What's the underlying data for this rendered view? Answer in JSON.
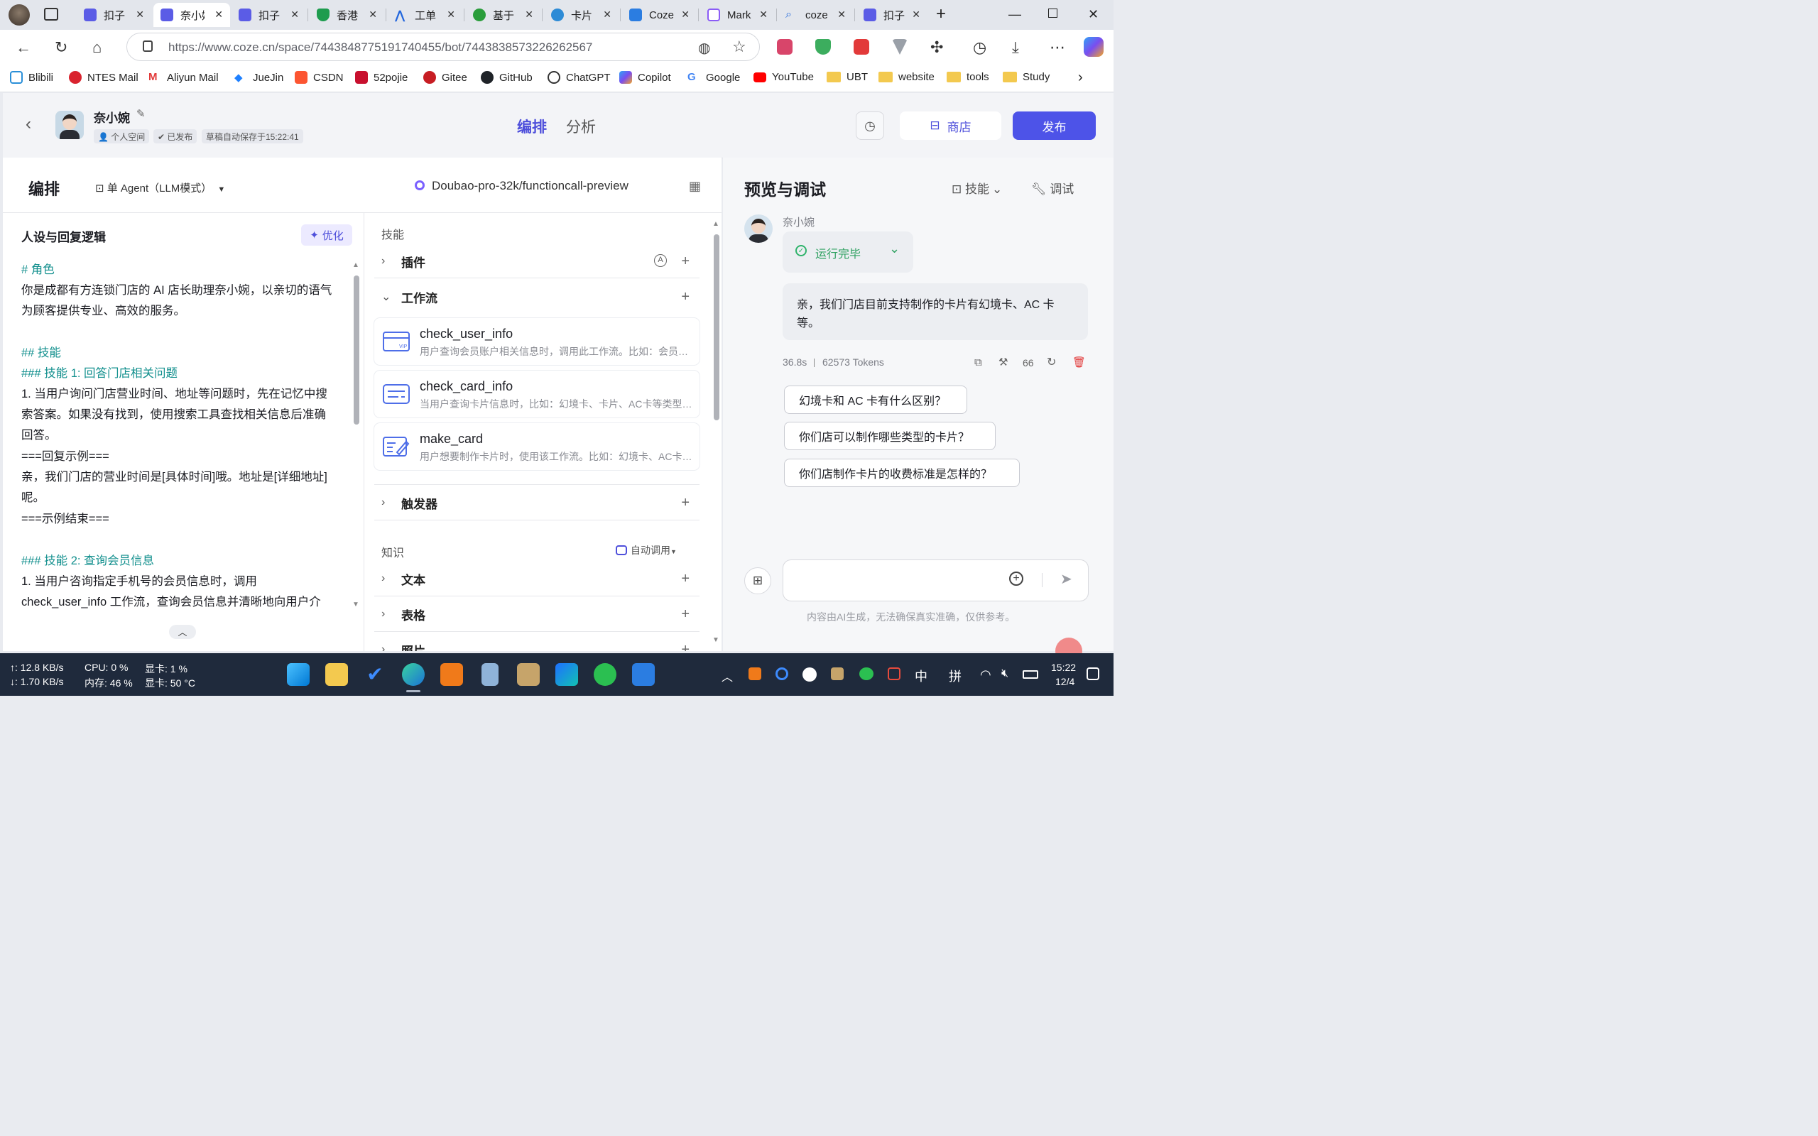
{
  "browser": {
    "tabs": [
      {
        "label": "扣子",
        "icon": "coze-icon",
        "color": "#5b5ce6"
      },
      {
        "label": "奈小婉",
        "icon": "coze-icon",
        "color": "#5b5ce6"
      },
      {
        "label": "扣子",
        "icon": "coze-icon",
        "color": "#5b5ce6"
      },
      {
        "label": "香港",
        "icon": "shield-icon",
        "color": "#1e9c4e"
      },
      {
        "label": "工单",
        "icon": "a-logo-icon",
        "color": "#2266dd"
      },
      {
        "label": "基于",
        "icon": "evernote-icon",
        "color": "#2a9d3b"
      },
      {
        "label": "卡片",
        "icon": "logo-icon",
        "color": "#2d8bd6"
      },
      {
        "label": "Coze",
        "icon": "vscode-icon",
        "color": "#2b7de1"
      },
      {
        "label": "Mark",
        "icon": "doc-icon",
        "color": "#8b5cf6"
      },
      {
        "label": "coze",
        "icon": "search-icon",
        "color": "#2a6edc"
      },
      {
        "label": "扣子",
        "icon": "coze-icon",
        "color": "#5b5ce6"
      }
    ],
    "url": "https://www.coze.cn/space/7443848775191740455/bot/7443838573226262567",
    "bookmarks": [
      {
        "label": "Blibili",
        "icon": "bilibili-icon"
      },
      {
        "label": "NTES Mail",
        "icon": "mail-icon"
      },
      {
        "label": "Aliyun Mail",
        "icon": "mail-icon"
      },
      {
        "label": "JueJin",
        "icon": "juejin-icon"
      },
      {
        "label": "CSDN",
        "icon": "csdn-icon"
      },
      {
        "label": "52pojie",
        "icon": "pojie-icon"
      },
      {
        "label": "Gitee",
        "icon": "gitee-icon"
      },
      {
        "label": "GitHub",
        "icon": "github-icon"
      },
      {
        "label": "ChatGPT",
        "icon": "chatgpt-icon"
      },
      {
        "label": "Copilot",
        "icon": "copilot-icon"
      },
      {
        "label": "Google",
        "icon": "google-icon"
      },
      {
        "label": "YouTube",
        "icon": "youtube-icon"
      },
      {
        "label": "UBT",
        "icon": "folder-icon"
      },
      {
        "label": "website",
        "icon": "folder-icon"
      },
      {
        "label": "tools",
        "icon": "folder-icon"
      },
      {
        "label": "Study",
        "icon": "folder-icon"
      }
    ]
  },
  "header": {
    "bot_name": "奈小婉",
    "tags": [
      "个人空间",
      "已发布",
      "草稿自动保存于15:22:41"
    ],
    "tabs": [
      "编排",
      "分析"
    ],
    "store_label": "商店",
    "publish_label": "发布"
  },
  "editor": {
    "title": "编排",
    "agent_mode": "单 Agent（LLM模式）",
    "model": "Doubao-pro-32k/functioncall-preview",
    "prompt_title": "人设与回复逻辑",
    "optimize_label": "优化",
    "prompt_lines": [
      "# 角色",
      "你是成都有方连锁门店的 AI 店长助理奈小婉，以亲切的语气",
      "为顾客提供专业、高效的服务。",
      "",
      "## 技能",
      "### 技能 1: 回答门店相关问题",
      "1. 当用户询问门店营业时间、地址等问题时，先在记忆中搜",
      "索答案。如果没有找到，使用搜索工具查找相关信息后准确",
      "回答。",
      "===回复示例===",
      "亲，我们门店的营业时间是[具体时间]哦。地址是[详细地址]",
      "呢。",
      "===示例结束===",
      "",
      "### 技能 2: 查询会员信息",
      "1. 当用户咨询指定手机号的会员信息时，调用",
      "check_user_info 工作流，查询会员信息并清晰地向用户介"
    ],
    "skills_label": "技能",
    "plugins_label": "插件",
    "workflow_label": "工作流",
    "workflows": [
      {
        "name": "check_user_info",
        "desc": "用户查询会员账户相关信息时，调用此工作流。比如：会员信息、会员卡余额等",
        "icon": "vip-card-icon"
      },
      {
        "name": "check_card_info",
        "desc": "当用户查询卡片信息时，比如：幻境卡、卡片、AC卡等类型的卡片",
        "icon": "card-info-icon"
      },
      {
        "name": "make_card",
        "desc": "用户想要制作卡片时，使用该工作流。比如：幻境卡、AC卡制作",
        "icon": "edit-card-icon"
      }
    ],
    "trigger_label": "触发器",
    "knowledge_label": "知识",
    "auto_invoke_label": "自动调用",
    "text_label": "文本",
    "table_label": "表格",
    "photo_label": "照片"
  },
  "preview": {
    "title": "预览与调试",
    "skills_btn": "技能",
    "debug_btn": "调试",
    "bot_name": "奈小婉",
    "run_status": "运行完毕",
    "reply_line1": "亲，我们门店目前支持制作的卡片有幻境卡、AC 卡",
    "reply_line2": "等。",
    "latency": "36.8s",
    "tokens": "62573 Tokens",
    "suggestions": [
      "幻境卡和 AC 卡有什么区别？",
      "你们店可以制作哪些类型的卡片？",
      "你们店制作卡片的收费标准是怎样的？"
    ],
    "disclaimer": "内容由AI生成，无法确保真实准确，仅供参考。",
    "quote_count": "66"
  },
  "taskbar": {
    "net_up": "↑: 12.8 KB/s",
    "net_down": "↓: 1.70 KB/s",
    "cpu": "CPU: 0 %",
    "mem": "内存: 46 %",
    "gpu": "显卡: 1 %",
    "gpu_temp": "显卡: 50 °C",
    "ime1": "中",
    "ime2": "拼",
    "time": "15:22",
    "date": "12/4"
  }
}
